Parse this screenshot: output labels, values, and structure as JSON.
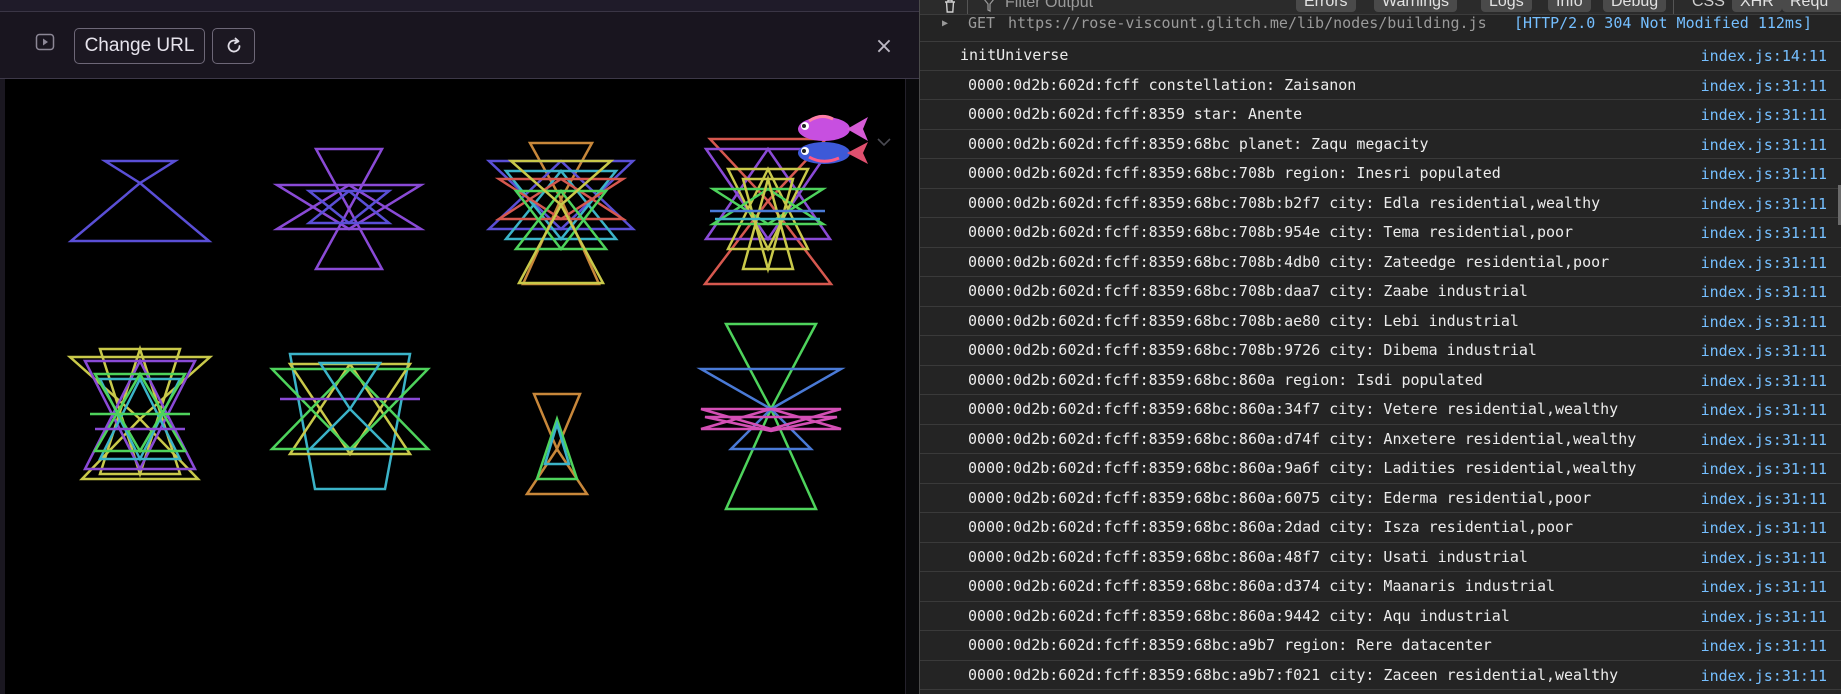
{
  "preview": {
    "change_url_label": "Change URL",
    "close_symbol": "×"
  },
  "console": {
    "filter_placeholder": "Filter Output",
    "filter_chips": [
      "Errors",
      "Warnings",
      "Logs",
      "Info",
      "Debug"
    ],
    "type_chips": [
      "CSS",
      "XHR",
      "Requests"
    ],
    "request": {
      "method": "GET",
      "url": "https://rose-viscount.glitch.me/lib/nodes/building.js",
      "status": "[HTTP/2.0  304 Not Modified 112ms]"
    },
    "logs": [
      {
        "msg": "initUniverse",
        "src": "index.js:14:11",
        "indent": 0
      },
      {
        "msg": "0000:0d2b:602d:fcff constellation: Zaisanon",
        "src": "index.js:31:11",
        "indent": 1
      },
      {
        "msg": "0000:0d2b:602d:fcff:8359 star: Anente",
        "src": "index.js:31:11",
        "indent": 1
      },
      {
        "msg": "0000:0d2b:602d:fcff:8359:68bc planet: Zaqu megacity",
        "src": "index.js:31:11",
        "indent": 1
      },
      {
        "msg": "0000:0d2b:602d:fcff:8359:68bc:708b region: Inesri populated",
        "src": "index.js:31:11",
        "indent": 1
      },
      {
        "msg": "0000:0d2b:602d:fcff:8359:68bc:708b:b2f7 city: Edla residential,wealthy",
        "src": "index.js:31:11",
        "indent": 1
      },
      {
        "msg": "0000:0d2b:602d:fcff:8359:68bc:708b:954e city: Tema residential,poor",
        "src": "index.js:31:11",
        "indent": 1
      },
      {
        "msg": "0000:0d2b:602d:fcff:8359:68bc:708b:4db0 city: Zateedge residential,poor",
        "src": "index.js:31:11",
        "indent": 1
      },
      {
        "msg": "0000:0d2b:602d:fcff:8359:68bc:708b:daa7 city: Zaabe industrial",
        "src": "index.js:31:11",
        "indent": 1
      },
      {
        "msg": "0000:0d2b:602d:fcff:8359:68bc:708b:ae80 city: Lebi industrial",
        "src": "index.js:31:11",
        "indent": 1
      },
      {
        "msg": "0000:0d2b:602d:fcff:8359:68bc:708b:9726 city: Dibema industrial",
        "src": "index.js:31:11",
        "indent": 1
      },
      {
        "msg": "0000:0d2b:602d:fcff:8359:68bc:860a region: Isdi populated",
        "src": "index.js:31:11",
        "indent": 1
      },
      {
        "msg": "0000:0d2b:602d:fcff:8359:68bc:860a:34f7 city: Vetere residential,wealthy",
        "src": "index.js:31:11",
        "indent": 1
      },
      {
        "msg": "0000:0d2b:602d:fcff:8359:68bc:860a:d74f city: Anxetere residential,wealthy",
        "src": "index.js:31:11",
        "indent": 1
      },
      {
        "msg": "0000:0d2b:602d:fcff:8359:68bc:860a:9a6f city: Ladities residential,wealthy",
        "src": "index.js:31:11",
        "indent": 1
      },
      {
        "msg": "0000:0d2b:602d:fcff:8359:68bc:860a:6075 city: Ederma residential,poor",
        "src": "index.js:31:11",
        "indent": 1
      },
      {
        "msg": "0000:0d2b:602d:fcff:8359:68bc:860a:2dad city: Isza residential,poor",
        "src": "index.js:31:11",
        "indent": 1
      },
      {
        "msg": "0000:0d2b:602d:fcff:8359:68bc:860a:48f7 city: Usati industrial",
        "src": "index.js:31:11",
        "indent": 1
      },
      {
        "msg": "0000:0d2b:602d:fcff:8359:68bc:860a:d374 city: Maanaris industrial",
        "src": "index.js:31:11",
        "indent": 1
      },
      {
        "msg": "0000:0d2b:602d:fcff:8359:68bc:860a:9442 city: Aqu industrial",
        "src": "index.js:31:11",
        "indent": 1
      },
      {
        "msg": "0000:0d2b:602d:fcff:8359:68bc:a9b7 region: Rere datacenter",
        "src": "index.js:31:11",
        "indent": 1
      },
      {
        "msg": "0000:0d2b:602d:fcff:8359:68bc:a9b7:f021 city: Zaceen residential,wealthy",
        "src": "index.js:31:11",
        "indent": 1
      }
    ]
  },
  "icons": {
    "show_panel": "play-square-icon",
    "refresh": "refresh-icon",
    "close": "close-icon",
    "trash": "trash-icon",
    "filter": "filter-icon",
    "fish_mascot": "fish-icon",
    "collapse": "chevron-down-icon"
  },
  "colors": {
    "link": "#75bfff",
    "console_bg": "#242424",
    "preview_bg": "#000000",
    "shape_palette": [
      "#5a4fd6",
      "#8a4ad6",
      "#c8873a",
      "#3bb3c8",
      "#c9c94a",
      "#4ed35c",
      "#d44fb5",
      "#d6584f",
      "#4a7ad6"
    ]
  }
}
